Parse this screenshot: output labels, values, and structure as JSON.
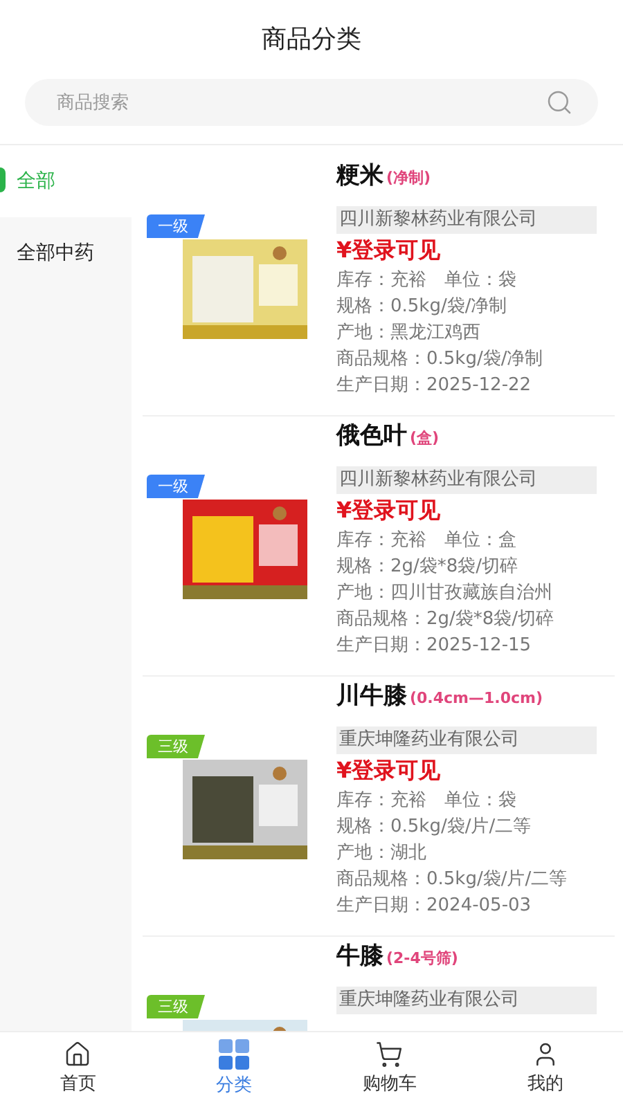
{
  "title": "商品分类",
  "search": {
    "placeholder": "商品搜索"
  },
  "categories": [
    {
      "label": "全部",
      "selected": true
    },
    {
      "label": "全部中药",
      "selected": false
    }
  ],
  "products": [
    {
      "name": "粳米",
      "spec": "(净制)",
      "grade": "一级",
      "color": "#3b82f6",
      "company": "四川新黎林药业有限公司",
      "price": "¥登录可见",
      "lines": [
        "库存：充裕　单位：袋",
        "规格：0.5kg/袋/净制",
        "产地：黑龙江鸡西",
        "商品规格：0.5kg/袋/净制",
        "生产日期：2025-12-22"
      ]
    },
    {
      "name": "俄色叶",
      "spec": "(盒)",
      "grade": "一级",
      "color": "#3b82f6",
      "company": "四川新黎林药业有限公司",
      "price": "¥登录可见",
      "lines": [
        "库存：充裕　单位：盒",
        "规格：2g/袋*8袋/切碎",
        "产地：四川甘孜藏族自治州",
        "商品规格：2g/袋*8袋/切碎",
        "生产日期：2025-12-15"
      ]
    },
    {
      "name": "川牛膝",
      "spec": "(0.4cm—1.0cm)",
      "grade": "三级",
      "color": "#6cbf2a",
      "company": "重庆坤隆药业有限公司",
      "price": "¥登录可见",
      "lines": [
        "库存：充裕　单位：袋",
        "规格：0.5kg/袋/片/二等",
        "产地：湖北",
        "商品规格：0.5kg/袋/片/二等",
        "生产日期：2024-05-03"
      ]
    },
    {
      "name": "牛膝",
      "spec": "(2-4号筛)",
      "grade": "三级",
      "color": "#6cbf2a",
      "company": "重庆坤隆药业有限公司"
    }
  ],
  "nav": [
    {
      "kind": "home",
      "label": "首页",
      "selected": false
    },
    {
      "kind": "grid",
      "label": "分类",
      "selected": true
    },
    {
      "kind": "cart",
      "label": "购物车",
      "selected": false
    },
    {
      "kind": "user",
      "label": "我的",
      "selected": false
    }
  ]
}
